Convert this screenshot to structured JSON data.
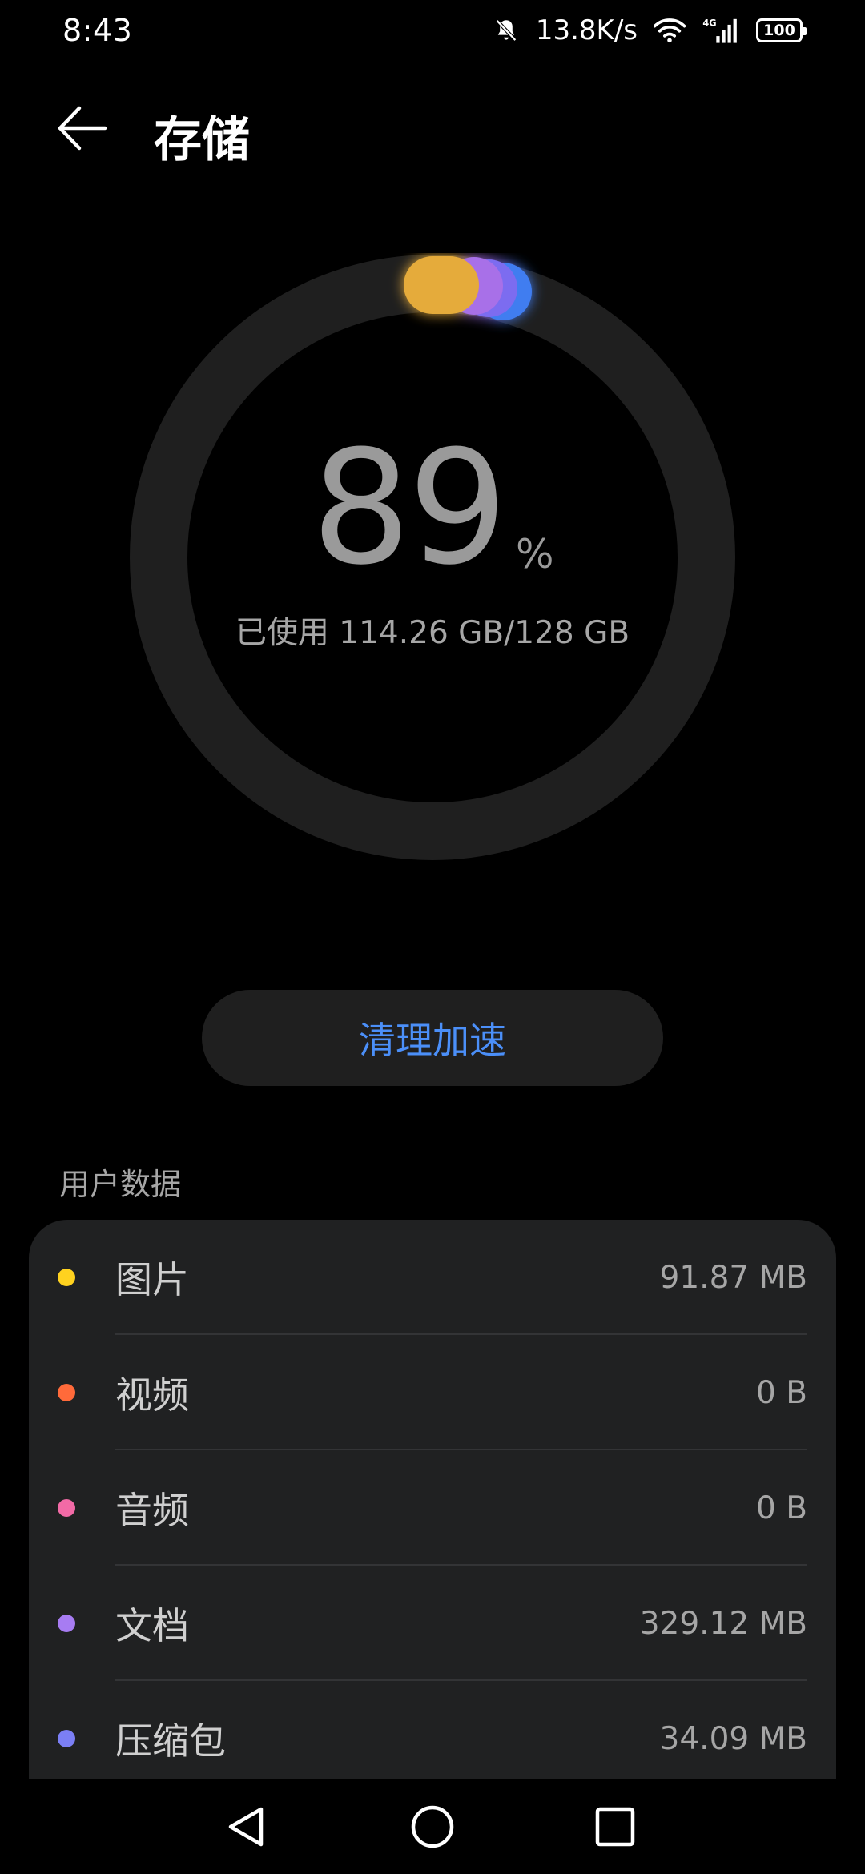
{
  "status_bar": {
    "time": "8:43",
    "network_speed": "13.8K/s",
    "network_type": "4G",
    "battery": "100"
  },
  "header": {
    "title": "存储"
  },
  "storage": {
    "percent": "89",
    "percent_sign": "%",
    "used_text": "已使用 114.26 GB/128 GB",
    "used_fraction": 0.89
  },
  "actions": {
    "clean_label": "清理加速"
  },
  "section": {
    "title": "用户数据"
  },
  "items": [
    {
      "label": "图片",
      "value": "91.87 MB",
      "color": "#ffd21f"
    },
    {
      "label": "视频",
      "value": "0 B",
      "color": "#ff6a3a"
    },
    {
      "label": "音频",
      "value": "0 B",
      "color": "#f26aa6"
    },
    {
      "label": "文档",
      "value": "329.12 MB",
      "color": "#a77cf2"
    },
    {
      "label": "压缩包",
      "value": "34.09 MB",
      "color": "#7b7ff5"
    }
  ],
  "colors": {
    "accent": "#4b8ff8",
    "ring_track": "#1f1f1f",
    "card_bg": "#202122"
  },
  "icons": {
    "back": "arrow-left-icon",
    "mute": "bell-off-icon",
    "wifi": "wifi-icon",
    "signal": "signal-icon",
    "nav_back": "triangle-back-icon",
    "nav_home": "circle-home-icon",
    "nav_recent": "square-recent-icon"
  }
}
